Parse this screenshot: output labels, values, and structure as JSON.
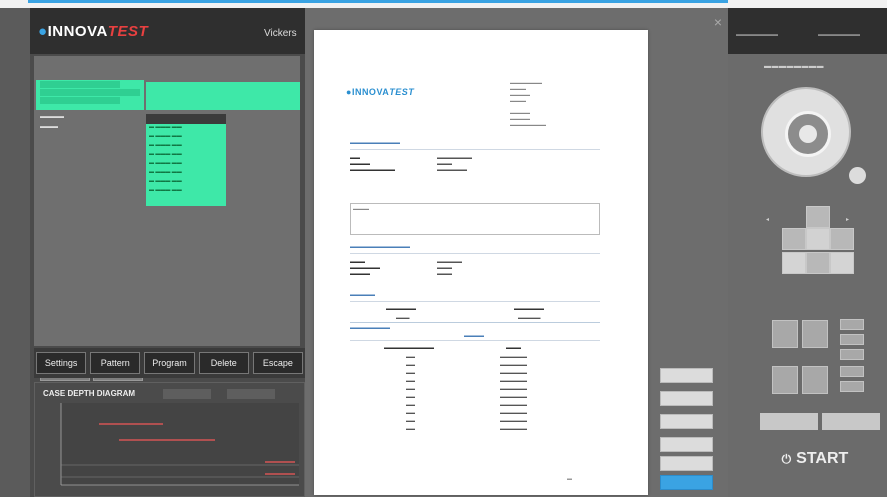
{
  "app": {
    "brand_prefix": "INNOVA",
    "brand_suffix": "TEST",
    "header_label": "Vickers"
  },
  "menu": {
    "items": [
      "Settings",
      "Pattern",
      "Program",
      "Delete",
      "Escape"
    ]
  },
  "chart_panel": {
    "title": "CASE DEPTH DIAGRAM"
  },
  "colors": {
    "accent": "#3aa3e3",
    "selection": "#3ee8a8",
    "brand_red": "#e84040",
    "start_text": "#eeeeee"
  },
  "controls": {
    "start_label": "START",
    "start_icon": "power-icon",
    "close_icon": "close-icon"
  }
}
